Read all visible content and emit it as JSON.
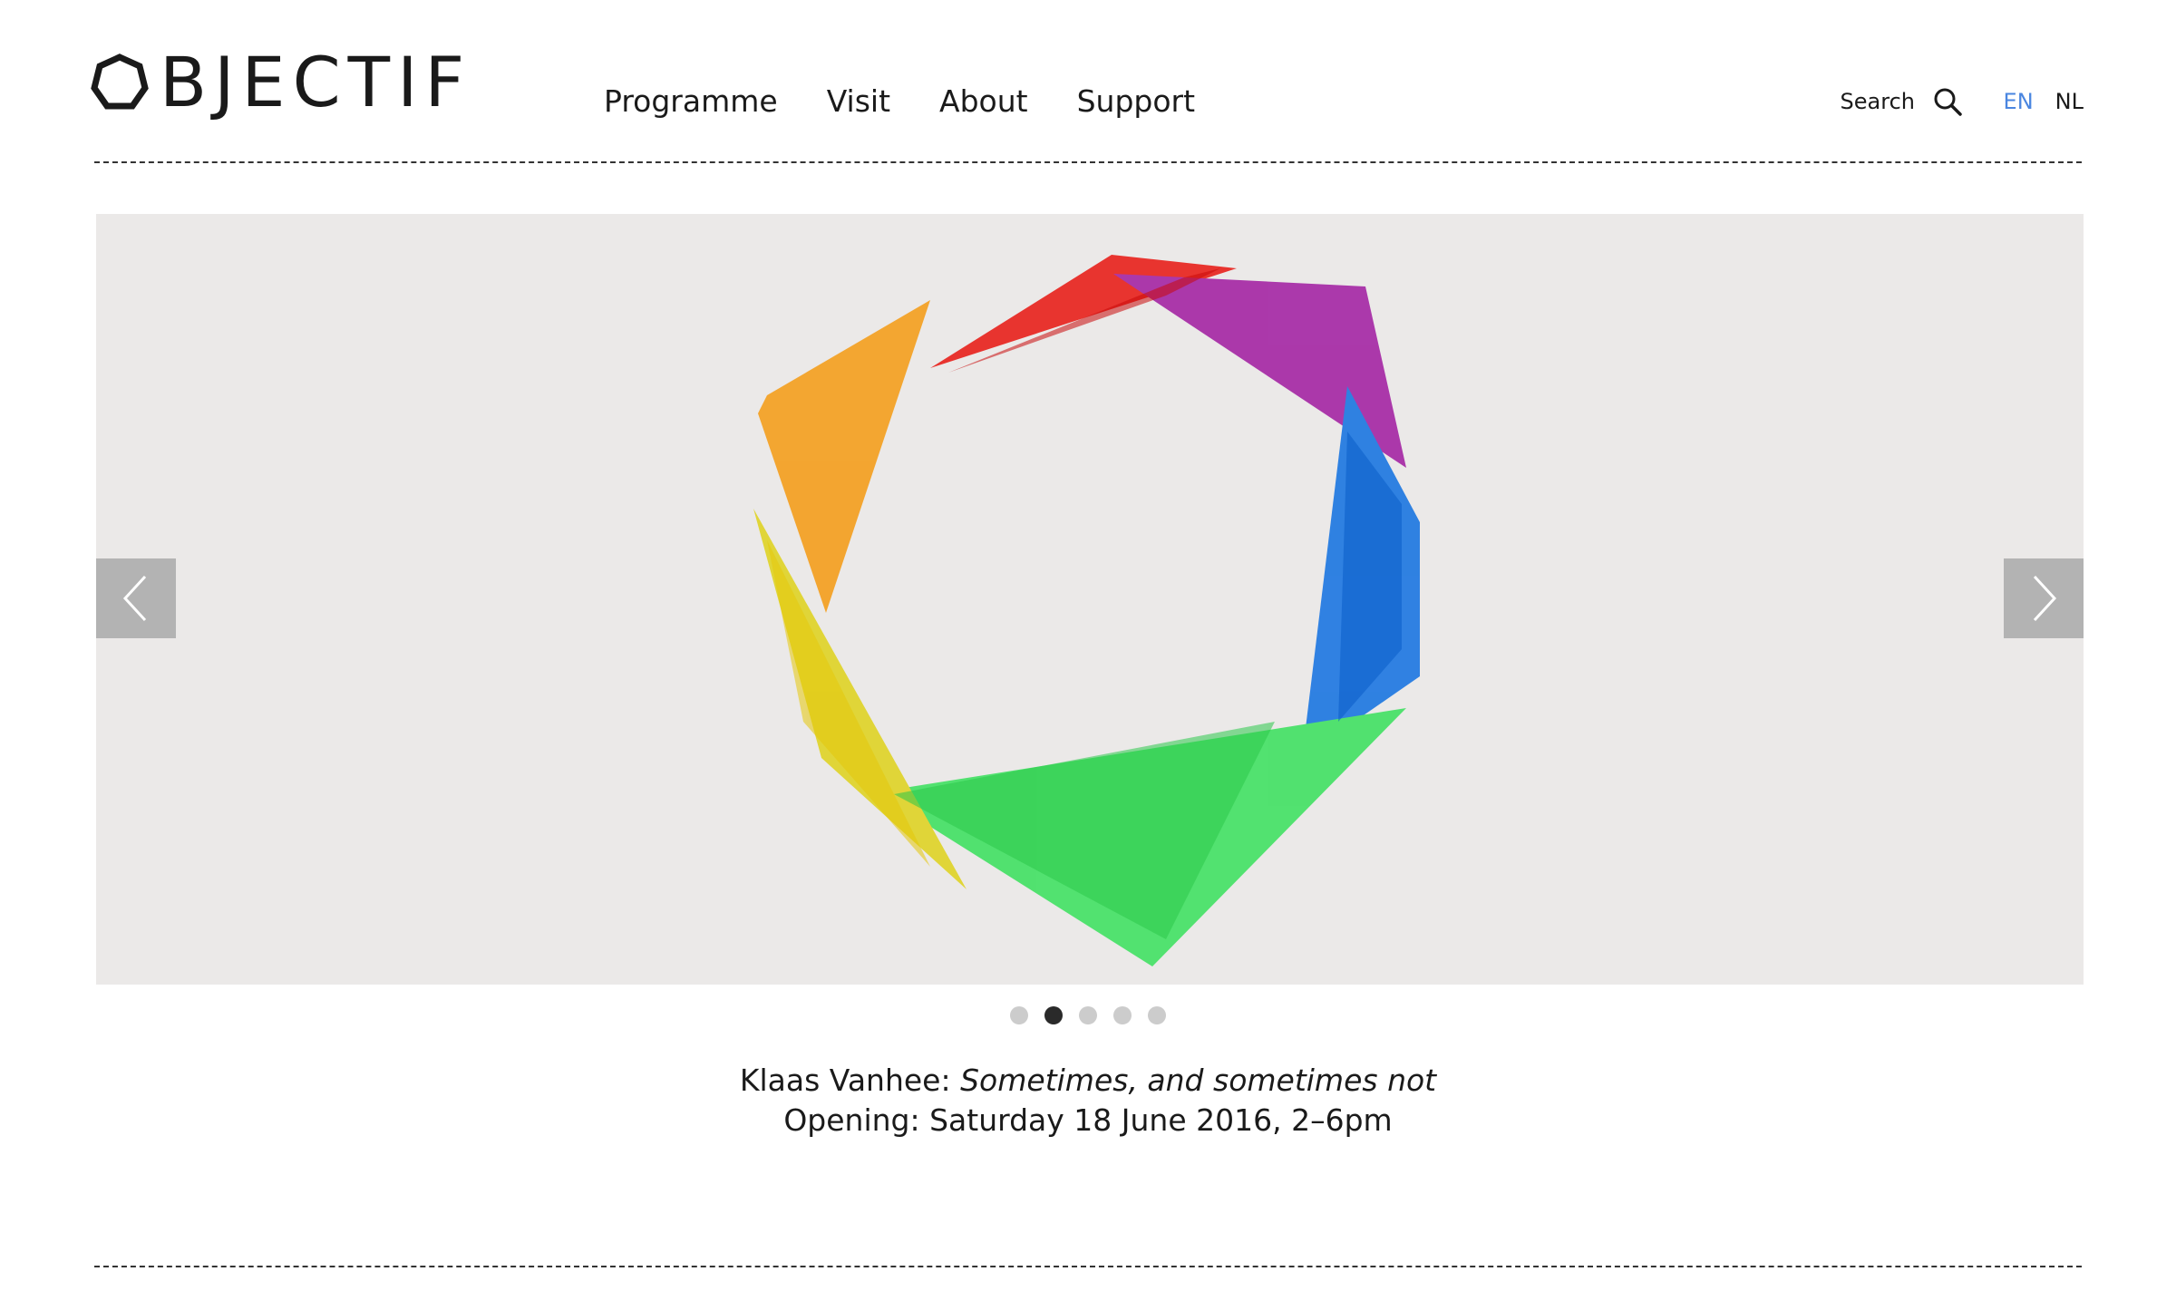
{
  "header": {
    "logo_text": "BJECTIF",
    "nav": [
      {
        "label": "Programme"
      },
      {
        "label": "Visit"
      },
      {
        "label": "About"
      },
      {
        "label": "Support"
      }
    ],
    "search_label": "Search",
    "languages": [
      {
        "label": "EN",
        "active": true
      },
      {
        "label": "NL",
        "active": false
      }
    ]
  },
  "slider": {
    "slide_count": 5,
    "active_index": 1,
    "image_description_icon": "colorful-triangles-ring-artwork",
    "background_color": "#ebe9e8",
    "arrow_color": "#b3b3b3"
  },
  "caption": {
    "artist": "Klaas Vanhee:",
    "title": "Sometimes, and sometimes not",
    "opening": "Opening: Saturday 18 June 2016, 2–6pm"
  },
  "colors": {
    "accent_language": "#4a86e0",
    "text": "#1a1a1a"
  }
}
